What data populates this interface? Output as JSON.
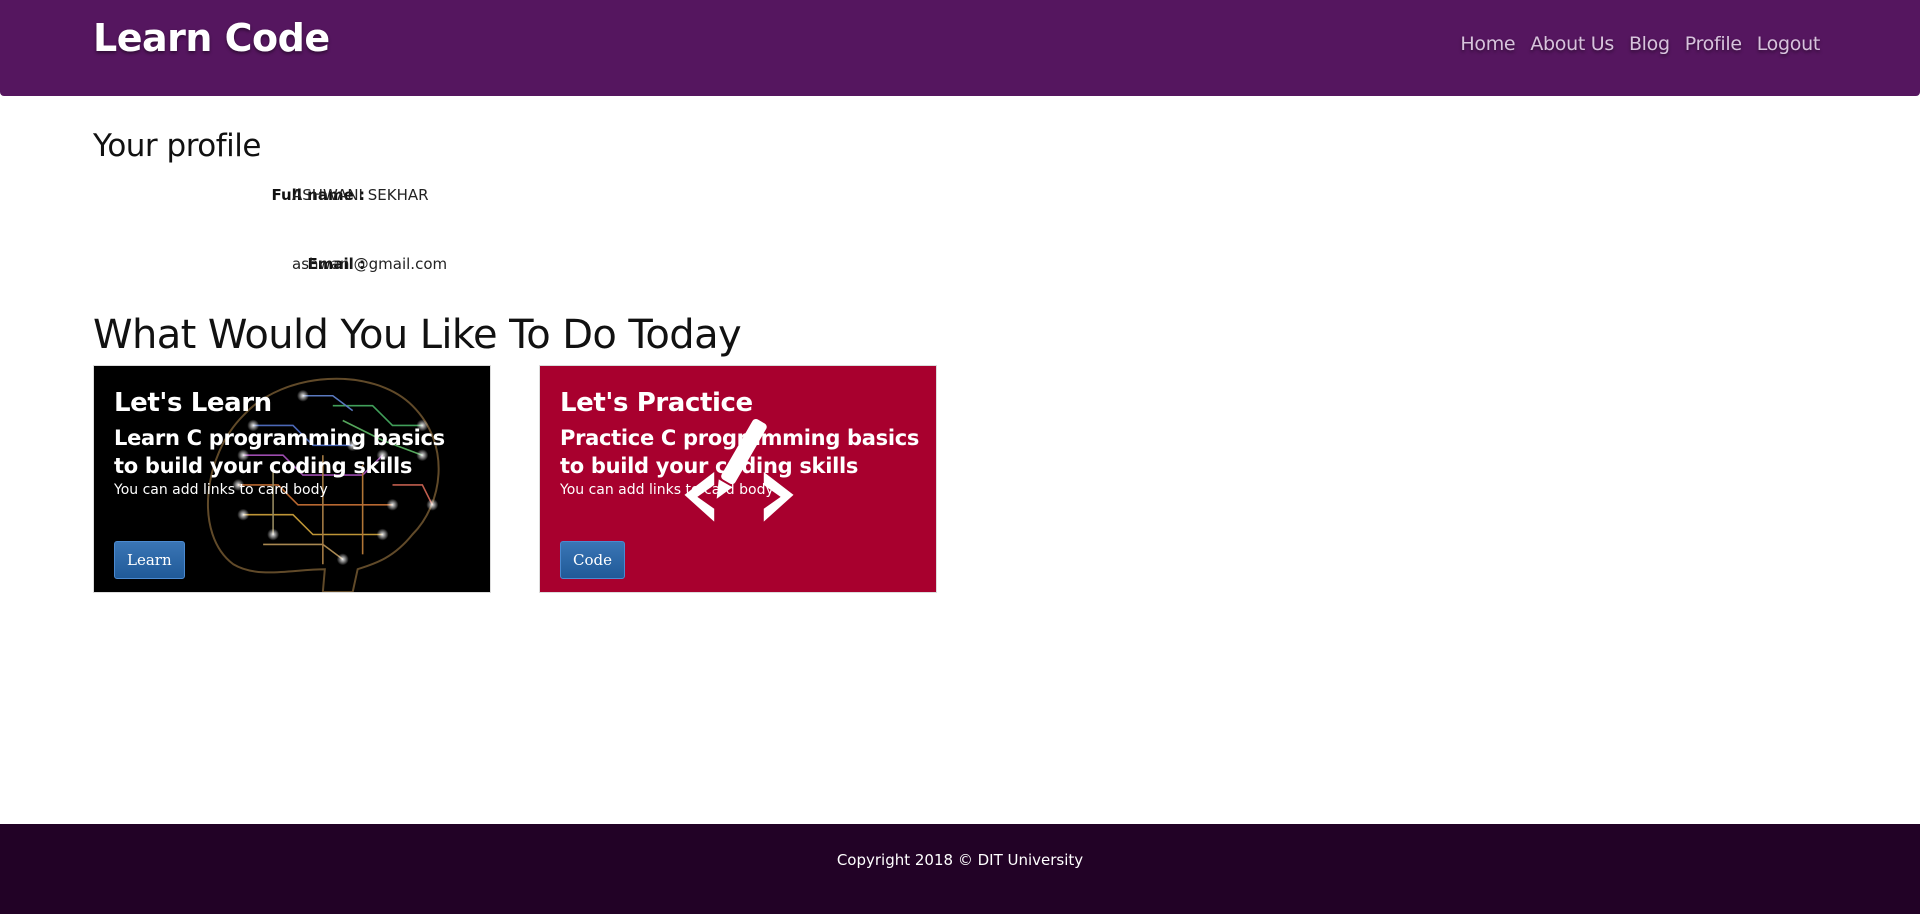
{
  "header": {
    "brand": "Learn Code",
    "nav": [
      "Home",
      "About Us",
      "Blog",
      "Profile",
      "Logout"
    ]
  },
  "profile": {
    "heading": "Your profile",
    "full_name_label": "Full name :",
    "full_name_value": "ASHWANI SEKHAR",
    "email_label": "Email :",
    "email_value": "ashwani@gmail.com"
  },
  "activities": {
    "heading": "What Would You Like To Do Today",
    "cards": [
      {
        "title": "Let's Learn",
        "subtitle": "Learn C programming basics to build your coding skills",
        "text": "You can add links to card body",
        "button": "Learn",
        "icon": "circuit-brain-icon"
      },
      {
        "title": "Let's Practice",
        "subtitle": "Practice C programming basics to build your coding skills",
        "text": "You can add links to card body",
        "button": "Code",
        "icon": "code-pencil-icon"
      }
    ]
  },
  "footer": {
    "copyright": "Copyright 2018 © DIT University"
  },
  "colors": {
    "navbar": "#55165f",
    "footer": "#220226",
    "practice_card": "#a8002e",
    "button": "#2a64a6"
  }
}
